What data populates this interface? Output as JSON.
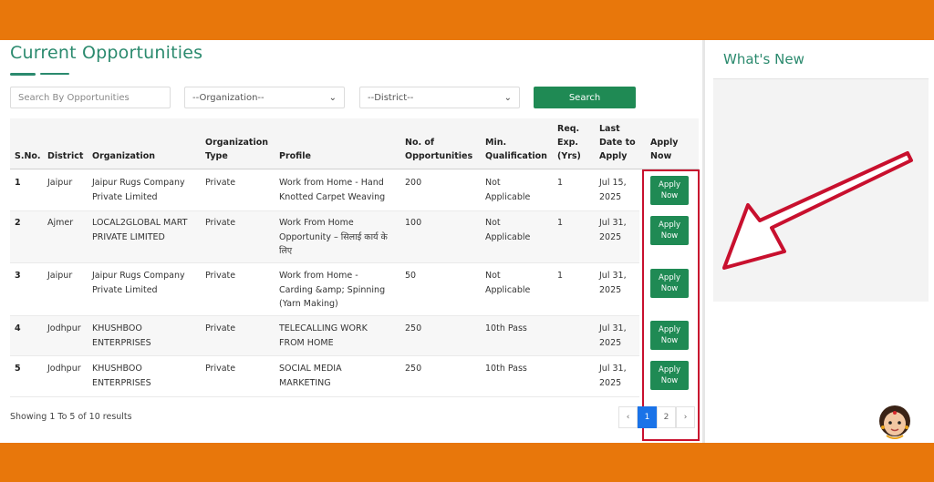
{
  "page": {
    "title": "Current Opportunities",
    "search_placeholder": "Search By Opportunities",
    "organization_select": "--Organization--",
    "district_select": "--District--",
    "search_button": "Search"
  },
  "table": {
    "headers": {
      "sno": "S.No.",
      "district": "District",
      "organization": "Organization",
      "org_type_1": "Organization",
      "org_type_2": "Type",
      "profile": "Profile",
      "opps_1": "No. of",
      "opps_2": "Opportunities",
      "qual_1": "Min.",
      "qual_2": "Qualification",
      "exp_1": "Req.",
      "exp_2": "Exp.",
      "exp_3": "(Yrs)",
      "date_1": "Last",
      "date_2": "Date to",
      "date_3": "Apply",
      "apply_1": "Apply",
      "apply_2": "Now"
    },
    "rows": [
      {
        "sno": "1",
        "district": "Jaipur",
        "org_1": "Jaipur Rugs Company",
        "org_2": "Private Limited",
        "type": "Private",
        "profile_1": "Work from Home - Hand",
        "profile_2": "Knotted Carpet Weaving",
        "profile_3": "",
        "opportunities": "200",
        "qual_1": "Not",
        "qual_2": "Applicable",
        "exp": "1",
        "date_1": "Jul 15,",
        "date_2": "2025",
        "apply_1": "Apply",
        "apply_2": "Now"
      },
      {
        "sno": "2",
        "district": "Ajmer",
        "org_1": "LOCAL2GLOBAL MART",
        "org_2": "PRIVATE LIMITED",
        "type": "Private",
        "profile_1": "Work From Home",
        "profile_2": "Opportunity – सिलाई कार्य के",
        "profile_3": "लिए",
        "opportunities": "100",
        "qual_1": "Not",
        "qual_2": "Applicable",
        "exp": "1",
        "date_1": "Jul 31,",
        "date_2": "2025",
        "apply_1": "Apply",
        "apply_2": "Now"
      },
      {
        "sno": "3",
        "district": "Jaipur",
        "org_1": "Jaipur Rugs Company",
        "org_2": "Private Limited",
        "type": "Private",
        "profile_1": "Work from Home -",
        "profile_2": "Carding &amp; Spinning",
        "profile_3": "(Yarn Making)",
        "opportunities": "50",
        "qual_1": "Not",
        "qual_2": "Applicable",
        "exp": "1",
        "date_1": "Jul 31,",
        "date_2": "2025",
        "apply_1": "Apply",
        "apply_2": "Now"
      },
      {
        "sno": "4",
        "district": "Jodhpur",
        "org_1": "KHUSHBOO",
        "org_2": "ENTERPRISES",
        "type": "Private",
        "profile_1": "TELECALLING WORK",
        "profile_2": "FROM HOME",
        "profile_3": "",
        "opportunities": "250",
        "qual_1": "10th Pass",
        "qual_2": "",
        "exp": "",
        "date_1": "Jul 31,",
        "date_2": "2025",
        "apply_1": "Apply",
        "apply_2": "Now"
      },
      {
        "sno": "5",
        "district": "Jodhpur",
        "org_1": "KHUSHBOO",
        "org_2": "ENTERPRISES",
        "type": "Private",
        "profile_1": "SOCIAL MEDIA",
        "profile_2": "MARKETING",
        "profile_3": "",
        "opportunities": "250",
        "qual_1": "10th Pass",
        "qual_2": "",
        "exp": "",
        "date_1": "Jul 31,",
        "date_2": "2025",
        "apply_1": "Apply",
        "apply_2": "Now"
      }
    ]
  },
  "footer": {
    "showing": "Showing 1 To 5 of 10 results",
    "pagination": {
      "prev": "‹",
      "page_1": "1",
      "page_2": "2",
      "next": "›"
    }
  },
  "sidebar": {
    "title": "What's New"
  },
  "colors": {
    "brand_orange": "#e8770b",
    "accent_green": "#2b8a6e",
    "button_green": "#1f8a54",
    "highlight_red": "#c8102e",
    "page_active_blue": "#1a73e8"
  },
  "icons": {
    "select_chevron": "chevron-down-icon",
    "annotation": "red-arrow-icon",
    "mascot": "mascot-girl-icon"
  }
}
